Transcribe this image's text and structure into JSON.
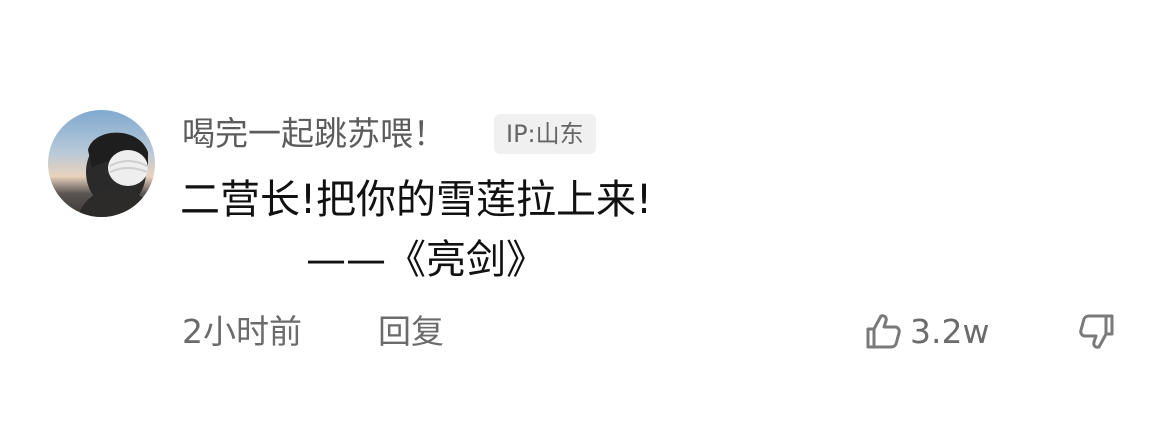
{
  "comment": {
    "username": "喝完一起跳苏喂！",
    "ip_label": "IP:山东",
    "body_line1": "二营长!把你的雪莲拉上来!",
    "body_line2": "——《亮剑》",
    "timestamp": "2小时前",
    "reply_label": "回复",
    "like_count": "3.2w"
  },
  "icons": {
    "like": "thumbs-up-icon",
    "dislike": "thumbs-down-icon",
    "avatar": "user-avatar"
  },
  "colors": {
    "username": "#5c5c5c",
    "body": "#111111",
    "meta": "#6b6b6b",
    "badge_bg": "#f0f0f0"
  }
}
